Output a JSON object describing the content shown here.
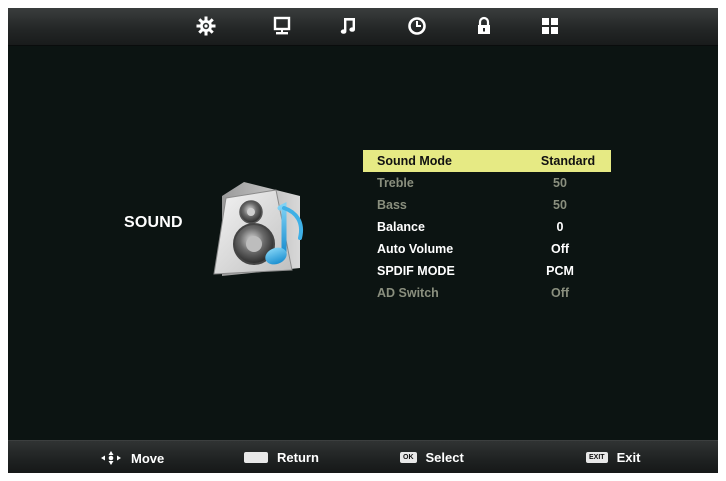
{
  "topbar": {
    "tabs": [
      {
        "name": "settings",
        "icon": "gear-icon"
      },
      {
        "name": "picture",
        "icon": "monitor-icon"
      },
      {
        "name": "sound",
        "icon": "music-note-icon"
      },
      {
        "name": "time",
        "icon": "clock-icon"
      },
      {
        "name": "lock",
        "icon": "lock-icon"
      },
      {
        "name": "setup",
        "icon": "grid-icon"
      }
    ]
  },
  "section": {
    "title": "SOUND",
    "icon": "speaker-note-icon"
  },
  "menu": {
    "items": [
      {
        "label": "Sound Mode",
        "value": "Standard",
        "state": "selected"
      },
      {
        "label": "Treble",
        "value": "50",
        "state": "disabled"
      },
      {
        "label": "Bass",
        "value": "50",
        "state": "disabled"
      },
      {
        "label": "Balance",
        "value": "0",
        "state": "normal"
      },
      {
        "label": "Auto Volume",
        "value": "Off",
        "state": "normal"
      },
      {
        "label": "SPDIF MODE",
        "value": "PCM",
        "state": "normal"
      },
      {
        "label": "AD Switch",
        "value": "Off",
        "state": "disabled"
      }
    ]
  },
  "help": {
    "move": "Move",
    "return": "Return",
    "select_key": "OK",
    "select": "Select",
    "exit_key": "EXIT",
    "exit": "Exit"
  },
  "colors": {
    "background": "#0c1412",
    "highlight": "#e6ea84",
    "disabled_text": "#8a8f7e"
  }
}
